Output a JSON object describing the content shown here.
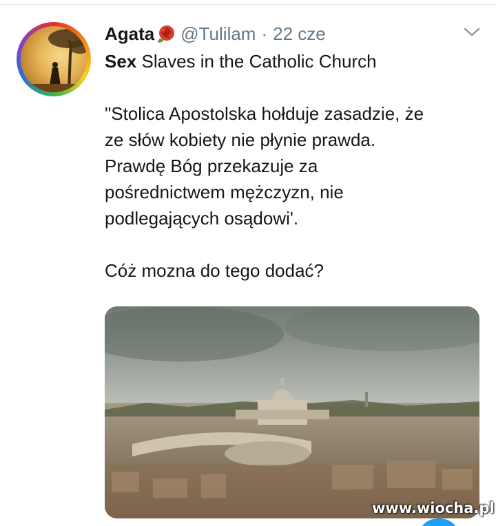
{
  "tweet": {
    "author_name": "Agata",
    "handle": "@Tulilam",
    "separator": "·",
    "date": "22 cze",
    "title_bold": "Sex",
    "title_rest": " Slaves in the Catholic Church",
    "quote_lines": [
      "\"Stolica Apostolska hołduje zasadzie, że",
      "ze słów kobiety nie płynie prawda.",
      "Prawdę Bóg przekazuje za",
      "pośrednictwem mężczyzn, nie",
      "podlegających osądowi'."
    ],
    "closing_line": "Cóż mozna do tego dodać?"
  },
  "icons": {
    "emoji": "rose-icon",
    "menu": "chevron-down-icon"
  },
  "media": {
    "image": "vatican-aerial-photo"
  },
  "watermark": "www.wiocha.pl",
  "colors": {
    "text": "#14171a",
    "muted": "#657786",
    "accent": "#1da1f2"
  }
}
